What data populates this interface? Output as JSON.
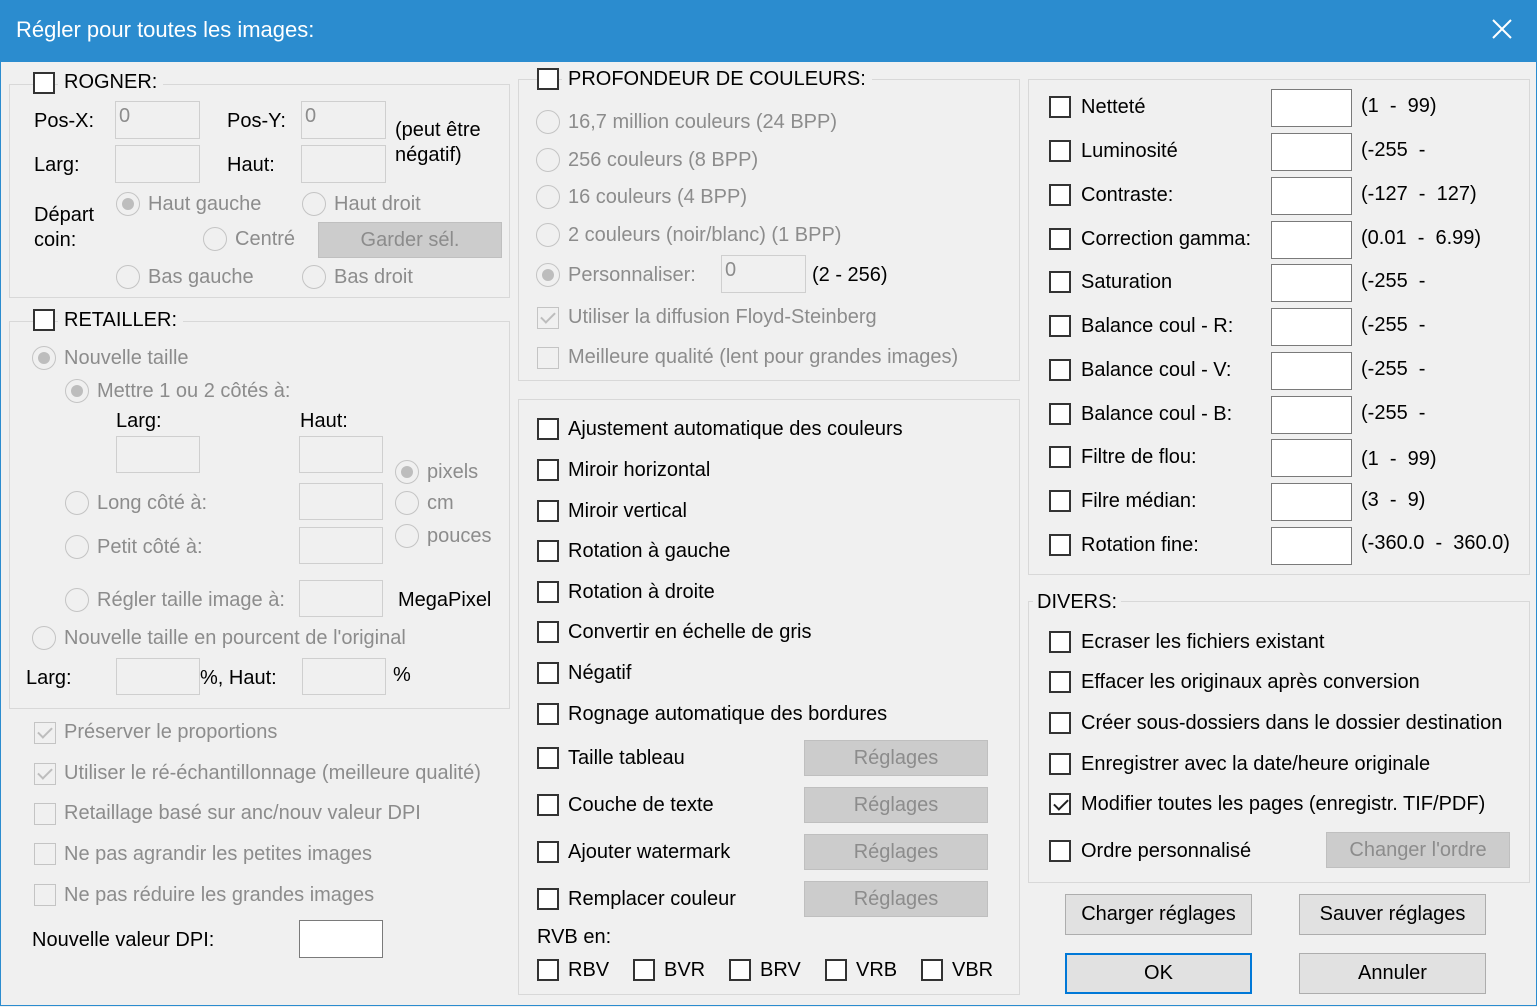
{
  "window": {
    "title": "Régler pour toutes les images:"
  },
  "crop": {
    "label": "ROGNER:",
    "posx_label": "Pos-X:",
    "posx_value": "0",
    "posy_label": "Pos-Y:",
    "posy_value": "0",
    "note": "(peut être\nnégatif)",
    "width_label": "Larg:",
    "height_label": "Haut:",
    "corner_label": "Départ\ncoin:",
    "top_left": "Haut gauche",
    "top_right": "Haut droit",
    "center": "Centré",
    "keep_sel": "Garder sél.",
    "bottom_left": "Bas gauche",
    "bottom_right": "Bas droit"
  },
  "resize": {
    "label": "RETAILLER:",
    "new_size": "Nouvelle taille",
    "set_sides": "Mettre 1 ou 2 côtés à:",
    "width_label": "Larg:",
    "height_label": "Haut:",
    "unit_pixels": "pixels",
    "unit_cm": "cm",
    "unit_inches": "pouces",
    "long_side": "Long côté à:",
    "short_side": "Petit côté à:",
    "set_image_size": "Régler taille image à:",
    "megapixel": "MegaPixel",
    "percent_size": "Nouvelle taille en pourcent de l'original",
    "pct_width_label": "Larg:",
    "pct_height_label": "%, Haut:",
    "pct_suffix": "%",
    "preserve": "Préserver le proportions",
    "resample": "Utiliser le ré-échantillonnage (meilleure qualité)",
    "dpi_based": "Retaillage basé sur anc/nouv valeur DPI",
    "no_enlarge": "Ne pas agrandir les petites images",
    "no_reduce": "Ne pas réduire les grandes images",
    "new_dpi": "Nouvelle valeur DPI:"
  },
  "color_depth": {
    "label": "PROFONDEUR DE COULEURS:",
    "opt24": "16,7 million couleurs (24 BPP)",
    "opt8": "256 couleurs (8 BPP)",
    "opt4": "16 couleurs (4 BPP)",
    "opt1": "2 couleurs (noir/blanc) (1 BPP)",
    "custom": "Personnaliser:",
    "custom_value": "0",
    "custom_range": "(2 - 256)",
    "floyd": "Utiliser la diffusion Floyd-Steinberg",
    "best_quality": "Meilleure qualité (lent pour grandes images)"
  },
  "ops": {
    "auto_color": "Ajustement automatique des couleurs",
    "mirror_h": "Miroir horizontal",
    "mirror_v": "Miroir vertical",
    "rotate_left": "Rotation à gauche",
    "rotate_right": "Rotation à droite",
    "grayscale": "Convertir en échelle de gris",
    "negative": "Négatif",
    "auto_crop": "Rognage automatique des bordures",
    "canvas_size": "Taille tableau",
    "text_layer": "Couche de texte",
    "watermark": "Ajouter watermark",
    "replace_color": "Remplacer couleur",
    "settings": "Réglages",
    "rgb_label": "RVB en:",
    "rgb_opts": [
      "RBV",
      "BVR",
      "BRV",
      "VRB",
      "VBR"
    ]
  },
  "adjust": {
    "sharpness": "Netteté",
    "sharpness_range": "(1  -  99)",
    "brightness": "Luminosité",
    "brightness_range": "(-255  -",
    "contrast": "Contraste:",
    "contrast_range": "(-127  -  127)",
    "gamma": "Correction gamma:",
    "gamma_range": "(0.01  -  6.99)",
    "saturation": "Saturation",
    "saturation_range": "(-255  -",
    "balance_r": "Balance coul - R:",
    "balance_r_range": "(-255  -",
    "balance_g": "Balance coul - V:",
    "balance_g_range": "(-255  -",
    "balance_b": "Balance coul - B:",
    "balance_b_range": "(-255  -",
    "blur": "Filtre de flou:",
    "blur_range": "(1  -  99)",
    "median": "Filre médian:",
    "median_range": "(3  -  9)",
    "fine_rotate": "Rotation fine:",
    "fine_rotate_range": "(-360.0  -  360.0)"
  },
  "misc": {
    "label": "DIVERS:",
    "overwrite": "Ecraser les fichiers existant",
    "delete_originals": "Effacer les originaux après conversion",
    "create_subfolders": "Créer sous-dossiers dans le dossier destination",
    "keep_date": "Enregistrer avec la date/heure originale",
    "all_pages": "Modifier toutes les pages (enregistr. TIF/PDF)",
    "custom_order": "Ordre personnalisé",
    "change_order": "Changer l'ordre"
  },
  "buttons": {
    "load": "Charger réglages",
    "save": "Sauver réglages",
    "ok": "OK",
    "cancel": "Annuler"
  }
}
